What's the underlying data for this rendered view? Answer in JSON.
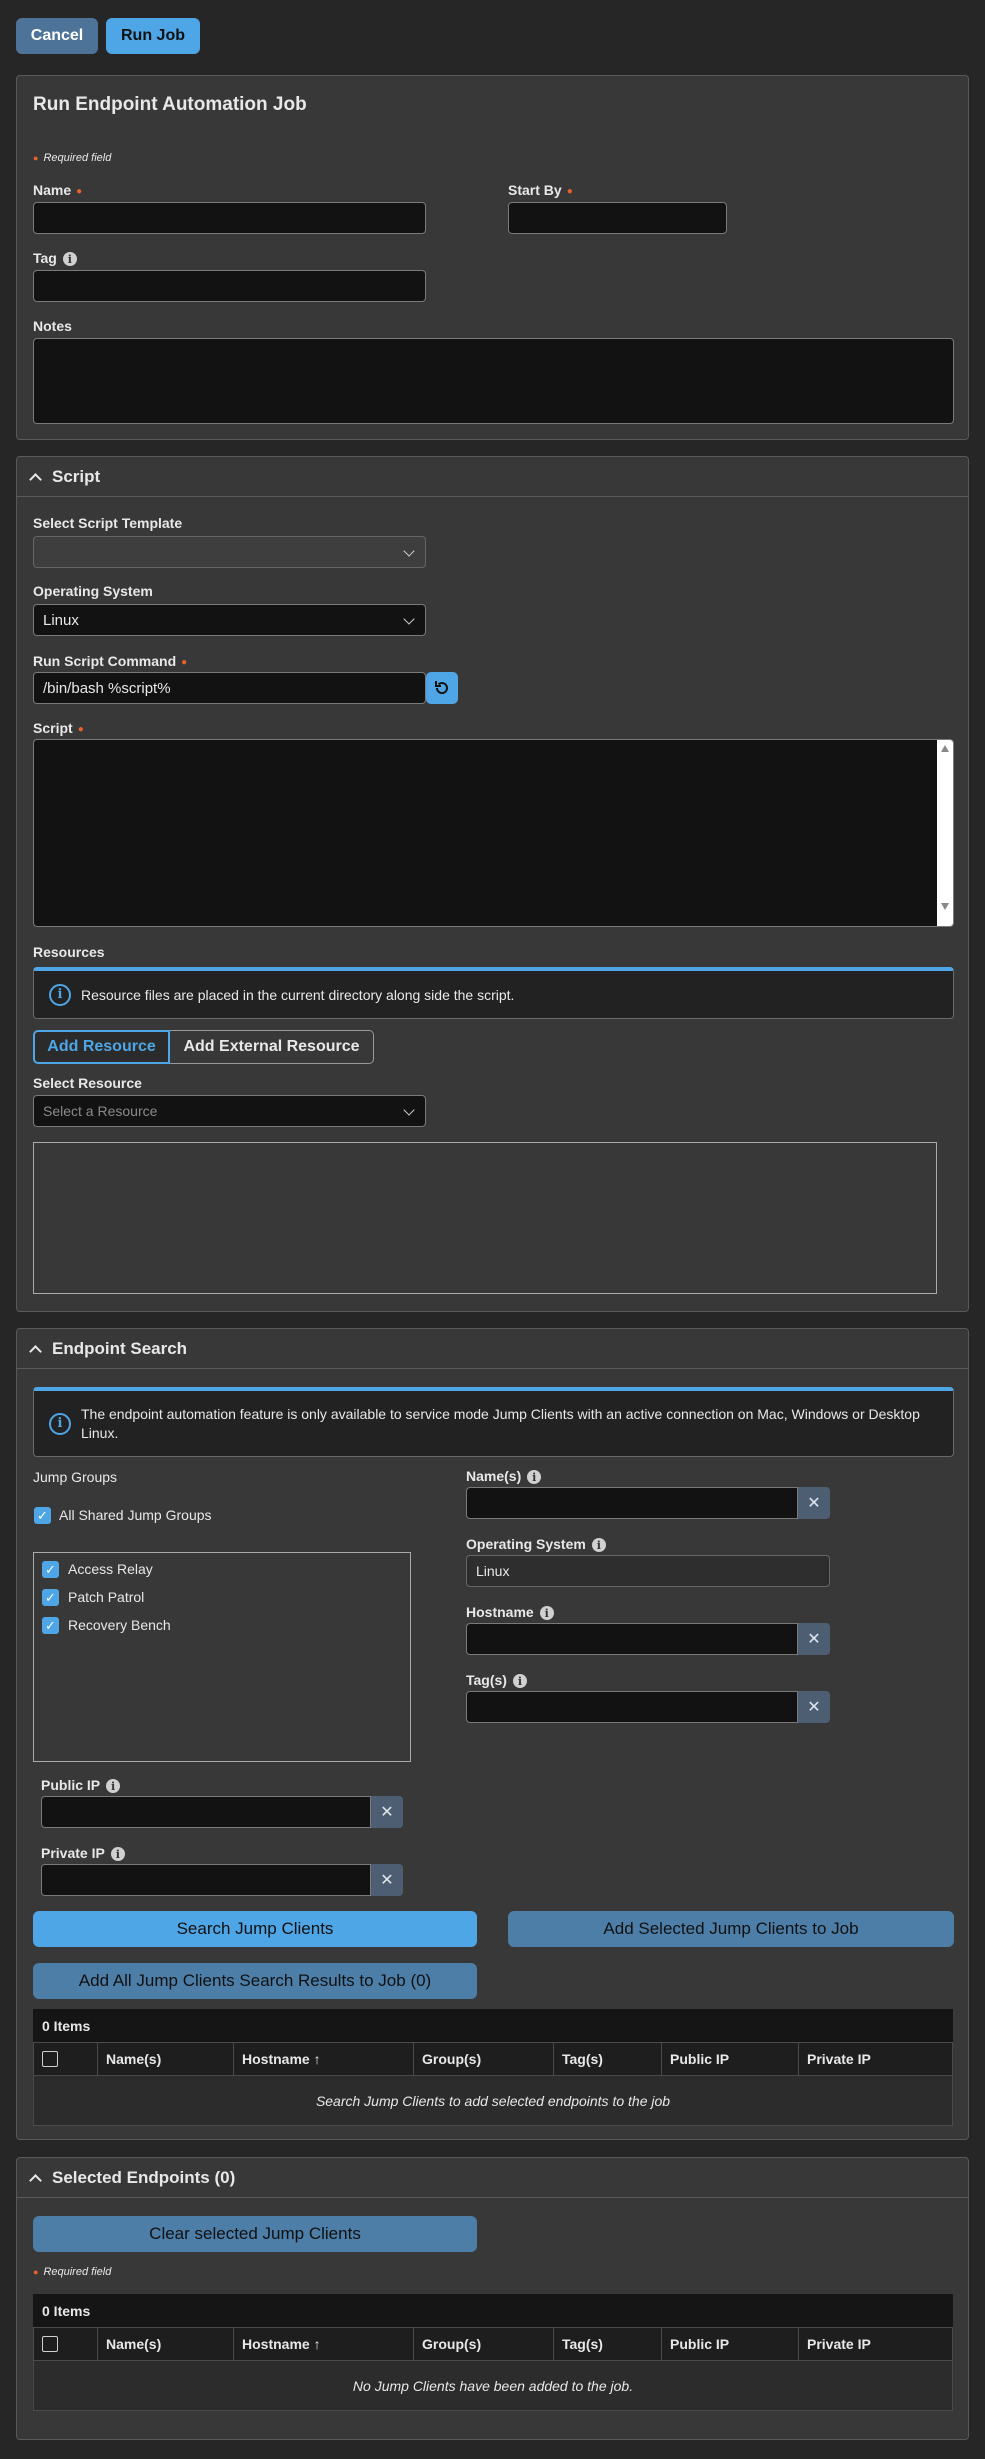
{
  "topbar": {
    "cancel": "Cancel",
    "run": "Run Job"
  },
  "job": {
    "title": "Run Endpoint Automation Job",
    "required_note": "Required field",
    "name_label": "Name",
    "start_by_label": "Start By",
    "tag_label": "Tag",
    "notes_label": "Notes"
  },
  "script": {
    "header": "Script",
    "template_label": "Select Script Template",
    "os_label": "Operating System",
    "os_value": "Linux",
    "command_label": "Run Script Command",
    "command_value": "/bin/bash %script%",
    "script_label": "Script",
    "resources_label": "Resources",
    "resources_notice": "Resource files are placed in the current directory along side the script.",
    "tab_add": "Add Resource",
    "tab_external": "Add External Resource",
    "select_resource_label": "Select Resource",
    "select_resource_placeholder": "Select a Resource"
  },
  "search": {
    "header": "Endpoint Search",
    "notice": "The endpoint automation feature is only available to service mode Jump Clients with an active connection on Mac, Windows or Desktop Linux.",
    "jump_groups_label": "Jump Groups",
    "all_shared": "All Shared Jump Groups",
    "groups": [
      "Access Relay",
      "Patch Patrol",
      "Recovery Bench"
    ],
    "names_label": "Name(s)",
    "os_label": "Operating System",
    "os_value": "Linux",
    "hostname_label": "Hostname",
    "tags_label": "Tag(s)",
    "public_ip_label": "Public IP",
    "private_ip_label": "Private IP",
    "search_btn": "Search Jump Clients",
    "add_selected_btn": "Add Selected Jump Clients to Job",
    "add_all_btn": "Add All Jump Clients Search Results to Job (0)",
    "items": "0 Items",
    "columns": [
      "Name(s)",
      "Hostname ↑",
      "Group(s)",
      "Tag(s)",
      "Public IP",
      "Private IP"
    ],
    "empty": "Search Jump Clients to add selected endpoints to the job"
  },
  "selected": {
    "header": "Selected Endpoints (0)",
    "clear_btn": "Clear selected Jump Clients",
    "required_note": "Required field",
    "items": "0 Items",
    "columns": [
      "Name(s)",
      "Hostname ↑",
      "Group(s)",
      "Tag(s)",
      "Public IP",
      "Private IP"
    ],
    "empty": "No Jump Clients have been added to the job."
  },
  "colors": {
    "accent": "#4ea6e6",
    "required": "#e8632a",
    "panel": "#383838"
  }
}
